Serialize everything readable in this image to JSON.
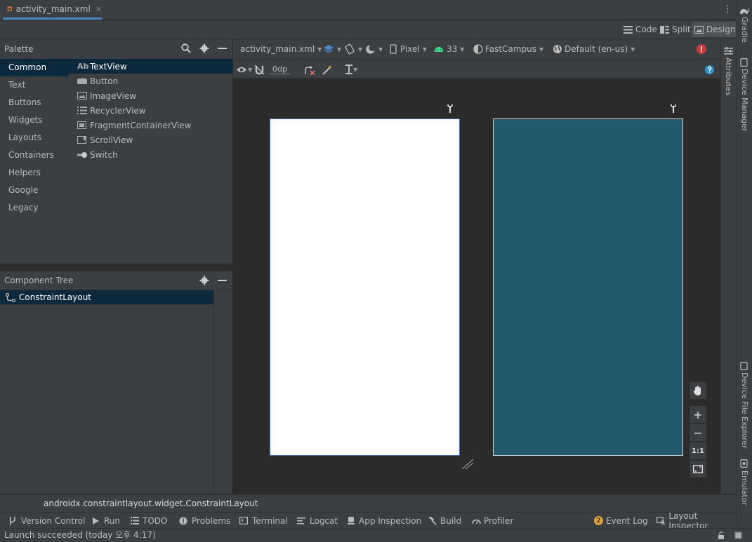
{
  "editor_tab": {
    "filename": "activity_main.xml",
    "close": "×"
  },
  "modes": {
    "code": "Code",
    "split": "Split",
    "design": "Design"
  },
  "palette": {
    "title": "Palette",
    "categories": [
      "Common",
      "Text",
      "Buttons",
      "Widgets",
      "Layouts",
      "Containers",
      "Helpers",
      "Google",
      "Legacy"
    ],
    "selected_category": "Common",
    "items": [
      {
        "label": "TextView",
        "icon": "textview-icon",
        "glyph": "Ab"
      },
      {
        "label": "Button",
        "icon": "button-icon",
        "glyph": ""
      },
      {
        "label": "ImageView",
        "icon": "image-icon",
        "glyph": ""
      },
      {
        "label": "RecyclerView",
        "icon": "list-icon",
        "glyph": ""
      },
      {
        "label": "FragmentContainerView",
        "icon": "fragment-icon",
        "glyph": ""
      },
      {
        "label": "ScrollView",
        "icon": "scrollview-icon",
        "glyph": ""
      },
      {
        "label": "Switch",
        "icon": "switch-icon",
        "glyph": ""
      }
    ]
  },
  "component_tree": {
    "title": "Component Tree",
    "root": "ConstraintLayout"
  },
  "design_toolbar": {
    "file": "activity_main.xml",
    "device": "Pixel",
    "api": "33",
    "theme": "FastCampus",
    "locale": "Default (en-us)",
    "margin": "0dp"
  },
  "zoom": {
    "plus": "+",
    "minus": "−",
    "one_to_one": "1:1"
  },
  "right_tools": {
    "gradle": "Gradle",
    "device_manager": "Device Manager",
    "device_file_explorer": "Device File Explorer",
    "emulator": "Emulator",
    "attributes": "Attributes"
  },
  "class_path": "androidx.constraintlayout.widget.ConstraintLayout",
  "tool_windows": [
    "Version Control",
    "Run",
    "TODO",
    "Problems",
    "Terminal",
    "Logcat",
    "App Inspection",
    "Build",
    "Profiler"
  ],
  "right_tool_windows": {
    "event_log": "Event Log",
    "event_count": "2",
    "layout_inspector": "Layout Inspector"
  },
  "status": "Launch succeeded (today 오후 4:17)",
  "colors": {
    "accent": "#4a88c7",
    "blueprint": "#225a6b",
    "error": "#c93b3b",
    "selection": "#0d293e"
  }
}
